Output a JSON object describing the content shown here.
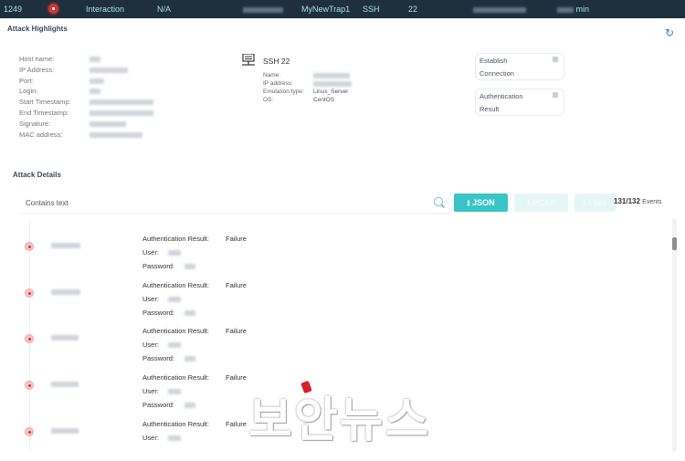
{
  "topbar": {
    "id": "1249",
    "severity": "critical",
    "type": "Interaction",
    "na": "N/A",
    "trap_name": "MyNewTrap1",
    "service": "SSH",
    "port": "22",
    "duration_unit": "min"
  },
  "highlights": {
    "title": "Attack Highlights",
    "refresh_icon": "refresh-icon",
    "fields": [
      "Host name:",
      "IP Address:",
      "Port:",
      "Login:",
      "Start Timestamp:",
      "End Timestamp:",
      "Signature:",
      "MAC address:"
    ],
    "service": {
      "title": "SSH 22",
      "icon": "server-icon",
      "fields": [
        {
          "label": "Name:",
          "value": ""
        },
        {
          "label": "IP address:",
          "value": ""
        },
        {
          "label": "Emulation type:",
          "value": "Linux_Server"
        },
        {
          "label": "OS:",
          "value": "CentOS"
        }
      ]
    },
    "cards": [
      {
        "line1": "Establish",
        "line2": "Connection"
      },
      {
        "line1": "Authentication",
        "line2": "Result"
      }
    ]
  },
  "details": {
    "title": "Attack Details",
    "search_placeholder": "Contains text",
    "buttons": {
      "json": "JSON",
      "pcap": "PCAP",
      "files": "Files"
    },
    "count": "131/132",
    "count_unit": "Events",
    "labels": {
      "auth": "Authentication Result:",
      "user": "User:",
      "password": "Password:"
    },
    "events": [
      {
        "result": "Failure"
      },
      {
        "result": "Failure"
      },
      {
        "result": "Failure"
      },
      {
        "result": "Failure"
      },
      {
        "result": "Failure"
      }
    ]
  },
  "watermark": "보안뉴스",
  "colors": {
    "topbar": "#1e2f3d",
    "accent": "#39c4c8",
    "critical": "#c83a3a"
  }
}
